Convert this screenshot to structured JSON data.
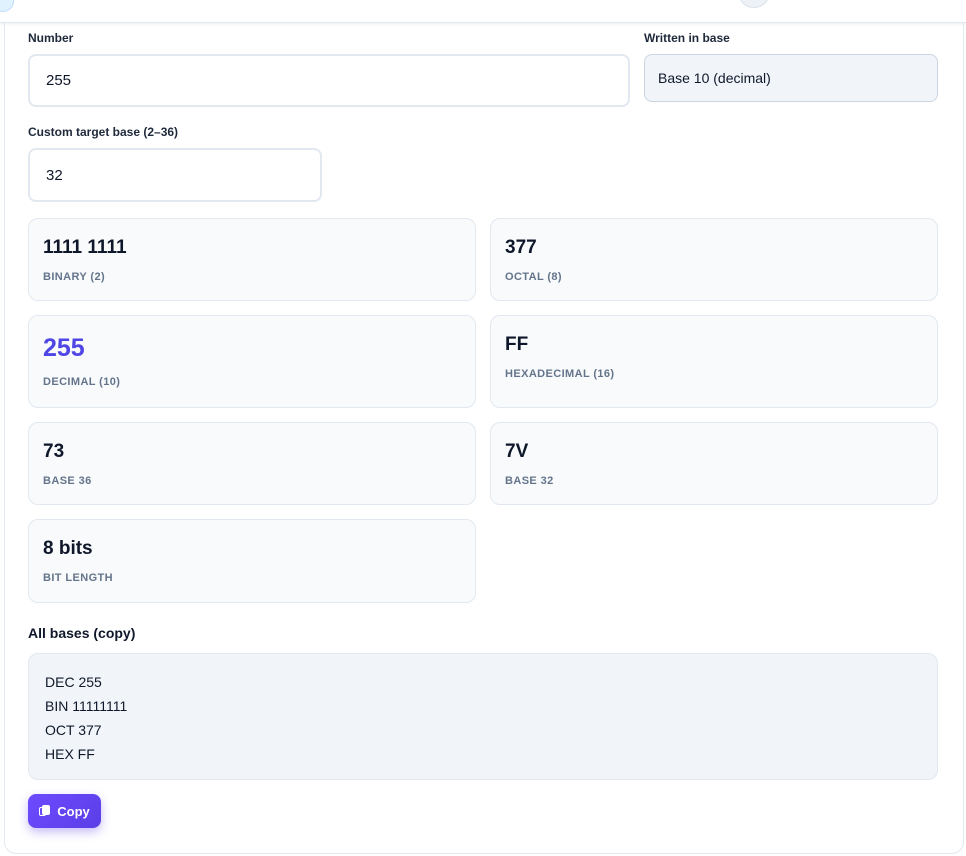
{
  "form": {
    "number_label": "Number",
    "number_value": "255",
    "base_label": "Written in base",
    "base_value": "Base 10 (decimal)",
    "custom_label": "Custom target base (2–36)",
    "custom_value": "32"
  },
  "results": [
    {
      "value": "1111 1111",
      "caption": "BINARY (2)"
    },
    {
      "value": "377",
      "caption": "OCTAL (8)"
    },
    {
      "value": "255",
      "caption": "DECIMAL (10)"
    },
    {
      "value": "FF",
      "caption": "HEXADECIMAL (16)"
    },
    {
      "value": "73",
      "caption": "BASE 36"
    },
    {
      "value": "7V",
      "caption": "BASE 32"
    },
    {
      "value": "8 bits",
      "caption": "BIT LENGTH"
    }
  ],
  "all_bases": {
    "title": "All bases (copy)",
    "lines": [
      "DEC 255",
      "BIN 11111111",
      "OCT 377",
      "HEX FF"
    ]
  },
  "copy_button": {
    "label": "Copy",
    "icon": "copy-icon"
  },
  "colors": {
    "accent": "#4f46e5",
    "button": "#5b3fe6"
  }
}
